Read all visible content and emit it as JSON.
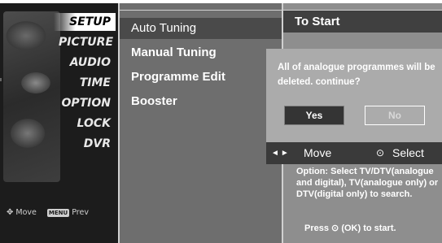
{
  "menu": {
    "items": [
      {
        "label": "SETUP",
        "active": true
      },
      {
        "label": "PICTURE"
      },
      {
        "label": "AUDIO"
      },
      {
        "label": "TIME"
      },
      {
        "label": "OPTION"
      },
      {
        "label": "LOCK"
      },
      {
        "label": "DVR"
      }
    ],
    "footer": {
      "move_icon": "move-icon",
      "move_label": "Move",
      "prev_key": "MENU",
      "prev_label": "Prev"
    }
  },
  "submenu": {
    "items": [
      {
        "label": "Auto Tuning",
        "active": true
      },
      {
        "label": "Manual Tuning"
      },
      {
        "label": "Programme Edit"
      },
      {
        "label": "Booster"
      }
    ]
  },
  "panel": {
    "title": "To Start",
    "option_text": "Option: Select TV/DTV(analogue and digital), TV(analogue only) or DTV(digital only) to search.",
    "press_prefix": "Press",
    "press_icon": "⊙",
    "press_suffix": "(OK) to start."
  },
  "dialog": {
    "message": "All of analogue programmes will be deleted. continue?",
    "yes_label": "Yes",
    "no_label": "No",
    "nav_arrows": "◄►",
    "move_label": "Move",
    "select_icon": "⊙",
    "select_label": "Select"
  }
}
